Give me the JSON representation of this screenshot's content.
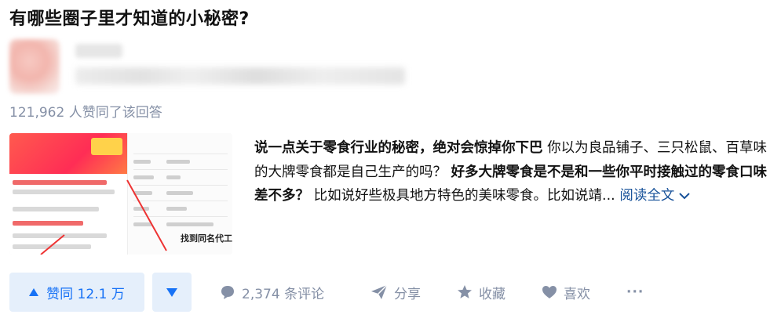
{
  "question": {
    "title": "有哪些圈子里才知道的小秘密?"
  },
  "answer": {
    "vote_summary": "121,962 人赞同了该回答",
    "excerpt": {
      "bold1": "说一点关于零食行业的秘密，绝对会惊掉你下巴",
      "normal1": " 你以为良品铺子、三只松鼠、百草味的大牌零食都是自己生产的吗？ ",
      "bold2": "好多大牌零食是不是和一些你平时接触过的零食口味差不多？",
      "normal2": " 比如说好些极具地方特色的美味零食。比如说靖...",
      "read_more": "阅读全文"
    },
    "thumbnail": {
      "caption": "找到同名代工"
    }
  },
  "actions": {
    "vote_up_label": "赞同 12.1 万",
    "comments_label": "2,374 条评论",
    "share_label": "分享",
    "favorite_label": "收藏",
    "like_label": "喜欢",
    "more_label": "···"
  },
  "colors": {
    "accent": "#1772f6",
    "accent_bg": "#e5effb",
    "muted": "#8590a6",
    "link": "#175199"
  },
  "icons": {
    "vote_up": "triangle-up-icon",
    "vote_down": "triangle-down-icon",
    "comment": "comment-bubble-icon",
    "share": "paper-plane-icon",
    "favorite": "star-icon",
    "like": "heart-icon",
    "more": "more-dots-icon",
    "read_more": "chevron-down-icon"
  }
}
